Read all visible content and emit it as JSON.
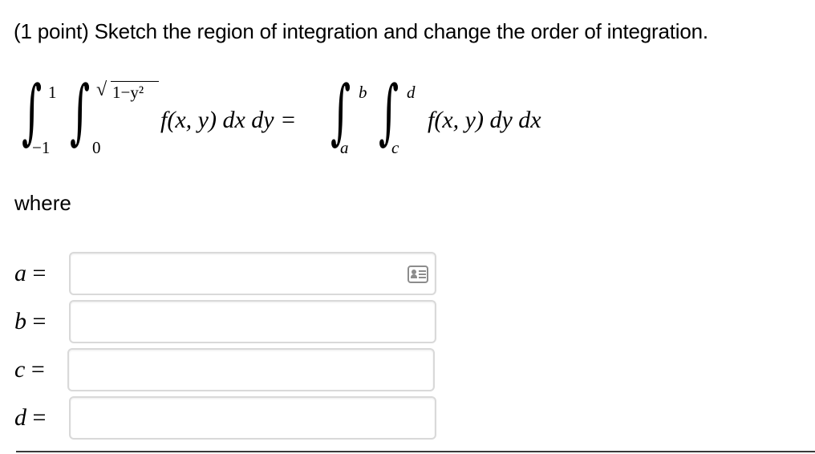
{
  "problem": {
    "points": "(1 point)",
    "text": "Sketch the region of integration and change the order of integration."
  },
  "equation": {
    "left_outer_upper": "1",
    "left_outer_lower": "−1",
    "left_inner_upper_radicand": "1−y²",
    "left_inner_lower": "0",
    "left_integrand": "f(x, y) dx dy =",
    "right_outer_upper": "b",
    "right_outer_lower": "a",
    "right_inner_upper": "d",
    "right_inner_lower": "c",
    "right_integrand": "f(x, y) dy dx"
  },
  "where_label": "where",
  "fields": [
    {
      "var": "a",
      "eq": "=",
      "value": ""
    },
    {
      "var": "b",
      "eq": "=",
      "value": ""
    },
    {
      "var": "c",
      "eq": "=",
      "value": ""
    },
    {
      "var": "d",
      "eq": "=",
      "value": ""
    }
  ],
  "icons": {
    "helper": "equation-editor-icon"
  }
}
